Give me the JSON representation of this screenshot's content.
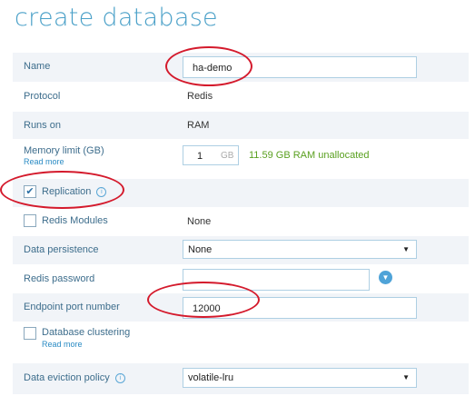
{
  "page": {
    "title": "create database"
  },
  "form": {
    "name": {
      "label": "Name",
      "value": "ha-demo"
    },
    "protocol": {
      "label": "Protocol",
      "value": "Redis"
    },
    "runs_on": {
      "label": "Runs on",
      "value": "RAM"
    },
    "memory": {
      "label": "Memory limit (GB)",
      "read_more": "Read more",
      "value": "1",
      "unit": "GB",
      "note": "11.59 GB RAM unallocated"
    },
    "replication": {
      "label": "Replication",
      "checked": true,
      "check_glyph": "✔",
      "icon": "info-icon"
    },
    "redis_modules": {
      "label": "Redis Modules",
      "checked": false,
      "value": "None"
    },
    "persistence": {
      "label": "Data persistence",
      "value": "None",
      "caret": "▼"
    },
    "password": {
      "label": "Redis password",
      "value": "",
      "icon": "chevron-down-circle-icon",
      "icon_glyph": "▼"
    },
    "port": {
      "label": "Endpoint port number",
      "value": "12000"
    },
    "clustering": {
      "label": "Database clustering",
      "read_more": "Read more",
      "checked": false
    },
    "eviction": {
      "label": "Data eviction policy",
      "value": "volatile-lru",
      "caret": "▼",
      "icon": "info-icon"
    }
  },
  "colors": {
    "title": "#4aa0c8",
    "label": "#3d6d8c",
    "shaded_row": "#f1f4f8",
    "annotation": "#d41a2c",
    "unallocated": "#5aa020"
  }
}
